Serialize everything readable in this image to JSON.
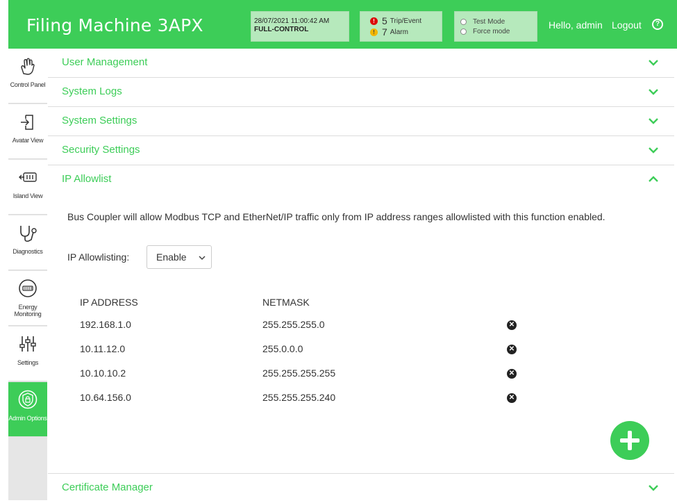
{
  "header": {
    "title": "Filing Machine 3APX",
    "datetime": "28/07/2021 11:00:42 AM",
    "control_mode": "FULL-CONTROL",
    "trip_count": "5",
    "trip_label": "Trip/Event",
    "alarm_count": "7",
    "alarm_label": "Alarm",
    "test_mode_label": "Test Mode",
    "force_mode_label": "Force mode",
    "greeting": "Hello, admin",
    "logout_label": "Logout",
    "help_glyph": "?",
    "accent_color": "#3dcd58"
  },
  "sidebar": {
    "items": [
      {
        "label": "Control Panel",
        "icon": "hand-pointer-icon"
      },
      {
        "label": "Avatar View",
        "icon": "login-arrow-icon"
      },
      {
        "label": "Island View",
        "icon": "island-module-icon"
      },
      {
        "label": "Diagnostics",
        "icon": "stethoscope-icon"
      },
      {
        "label": "Energy Monitoring",
        "icon": "meter-icon"
      },
      {
        "label": "Settings",
        "icon": "sliders-icon"
      },
      {
        "label": "Admin Options",
        "icon": "shield-lock-icon"
      }
    ]
  },
  "sections": [
    {
      "title": "User Management",
      "expanded": false
    },
    {
      "title": "System Logs",
      "expanded": false
    },
    {
      "title": "System Settings",
      "expanded": false
    },
    {
      "title": "Security Settings",
      "expanded": false
    },
    {
      "title": "IP Allowlist",
      "expanded": true
    },
    {
      "title": "Certificate Manager",
      "expanded": false
    }
  ],
  "ip_allowlist": {
    "description": "Bus Coupler will allow Modbus TCP and EtherNet/IP traffic only from IP address ranges allowlisted with this function enabled.",
    "label": "IP Allowlisting:",
    "selected": "Enable",
    "columns": [
      "IP ADDRESS",
      "NETMASK"
    ],
    "rows": [
      {
        "ip": "192.168.1.0",
        "netmask": "255.255.255.0"
      },
      {
        "ip": "10.11.12.0",
        "netmask": "255.0.0.0"
      },
      {
        "ip": "10.10.10.2",
        "netmask": "255.255.255.255"
      },
      {
        "ip": "10.64.156.0",
        "netmask": "255.255.255.240"
      }
    ]
  }
}
